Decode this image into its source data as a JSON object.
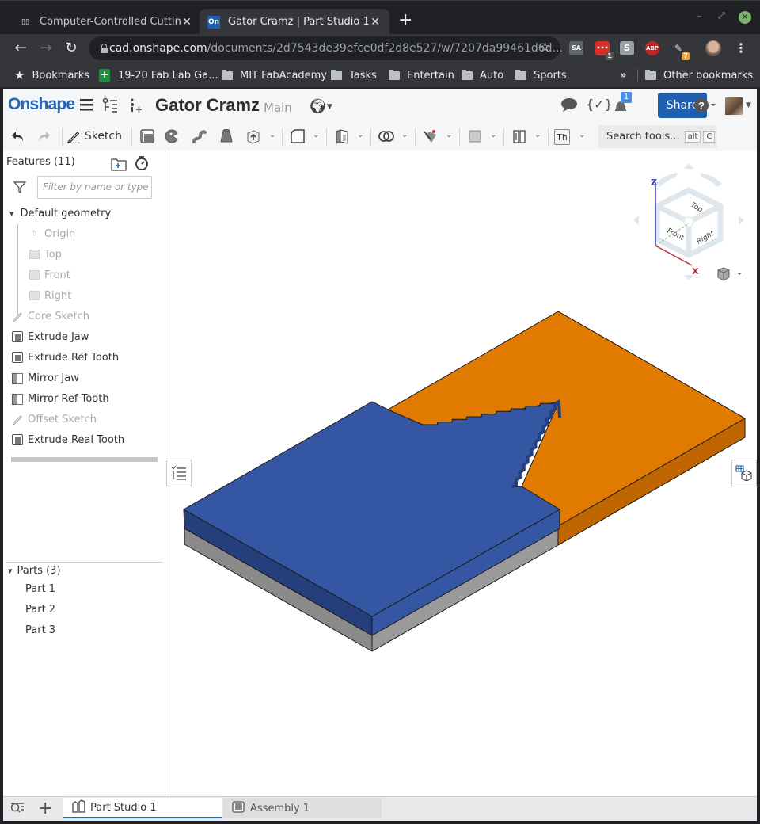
{
  "browser": {
    "tabs": [
      {
        "title": "Computer-Controlled Cutting",
        "favicon": "book-icon",
        "active": false
      },
      {
        "title": "Gator Cramz | Part Studio 1",
        "favicon": "onshape-icon",
        "favicon_text": "On",
        "active": true
      }
    ],
    "new_tab": "+",
    "url_host": "cad.onshape.com",
    "url_path": "/documents/2d7543de39efce0df2d8e527/w/7207da99461d6d...",
    "extensions": [
      {
        "name": "SA",
        "color": "#5f6368"
      },
      {
        "name": "todo",
        "badge": "1",
        "color": "#d93025"
      },
      {
        "name": "S",
        "color": "#9aa0a6"
      },
      {
        "name": "ABP",
        "color": "#c5221f"
      },
      {
        "name": "paint",
        "badge": "7",
        "color": "#e8a33a"
      }
    ],
    "bookmarks": [
      {
        "label": "Bookmarks",
        "icon": "star-icon"
      },
      {
        "label": "19-20 Fab Lab Ga...",
        "icon": "sheets-icon"
      },
      {
        "label": "MIT FabAcademy",
        "icon": "folder-icon"
      },
      {
        "label": "Tasks",
        "icon": "folder-icon"
      },
      {
        "label": "Entertain",
        "icon": "folder-icon"
      },
      {
        "label": "Auto",
        "icon": "folder-icon"
      },
      {
        "label": "Sports",
        "icon": "folder-icon"
      }
    ],
    "more_bookmarks": "»",
    "other_bookmarks": "Other bookmarks"
  },
  "app": {
    "logo": "Onshape",
    "document_title": "Gator Cramz",
    "branch": "Main",
    "notification_count": "1",
    "share_label": "Share",
    "help": "?",
    "toolbar": {
      "sketch_label": "Sketch",
      "search_label": "Search tools...",
      "shortcut_keys": [
        "alt",
        "C"
      ],
      "thicken_label": "Th"
    },
    "features": {
      "header": "Features (11)",
      "filter_placeholder": "Filter by name or type",
      "default_geometry": "Default geometry",
      "default_items": [
        "Origin",
        "Top",
        "Front",
        "Right"
      ],
      "items": [
        {
          "label": "Core Sketch",
          "type": "sketch",
          "dim": true
        },
        {
          "label": "Extrude Jaw",
          "type": "extrude",
          "dim": false
        },
        {
          "label": "Extrude Ref Tooth",
          "type": "extrude",
          "dim": false
        },
        {
          "label": "Mirror Jaw",
          "type": "mirror",
          "dim": false
        },
        {
          "label": "Mirror Ref Tooth",
          "type": "mirror",
          "dim": false
        },
        {
          "label": "Offset Sketch",
          "type": "sketch",
          "dim": true
        },
        {
          "label": "Extrude Real Tooth",
          "type": "extrude",
          "dim": false
        }
      ]
    },
    "parts": {
      "header": "Parts (3)",
      "items": [
        "Part 1",
        "Part 2",
        "Part 3"
      ]
    },
    "view_cube": {
      "faces": [
        "Top",
        "Front",
        "Right"
      ],
      "axes": [
        "Z",
        "X"
      ]
    },
    "model_colors": {
      "blue_top": "#3557a3",
      "blue_side": "#253f7d",
      "orange_top": "#e07a00",
      "orange_side": "#c06600",
      "gray_side": "#8a8a8a"
    },
    "bottom_tabs": [
      {
        "label": "Part Studio 1",
        "active": true
      },
      {
        "label": "Assembly 1",
        "active": false
      }
    ]
  }
}
